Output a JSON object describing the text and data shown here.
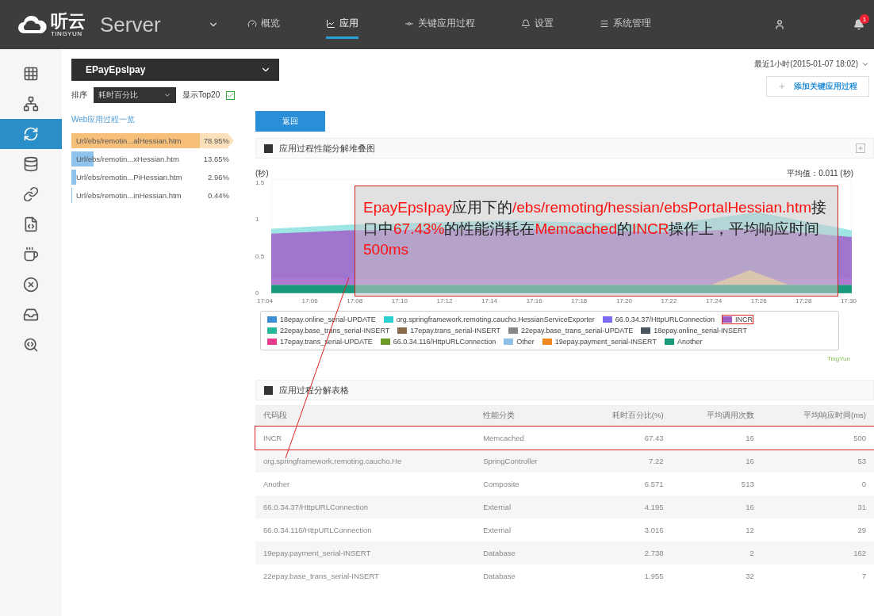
{
  "header": {
    "logo_text": "听云",
    "logo_sub": "TINGYUN",
    "product": "Server",
    "nav": [
      {
        "label": "概览",
        "kind": "gauge",
        "selected": false
      },
      {
        "label": "应用",
        "kind": "chart",
        "selected": true
      },
      {
        "label": "关键应用过程",
        "kind": "commit",
        "selected": false
      },
      {
        "label": "设置",
        "kind": "bell",
        "selected": false
      },
      {
        "label": "系统管理",
        "kind": "list",
        "selected": false
      }
    ],
    "notifications": "1"
  },
  "sidebar": {
    "items": [
      {
        "kind": "grid",
        "selected": false
      },
      {
        "kind": "tree",
        "selected": false
      },
      {
        "kind": "refresh",
        "selected": true
      },
      {
        "kind": "database",
        "selected": false
      },
      {
        "kind": "link",
        "selected": false
      },
      {
        "kind": "code",
        "selected": false
      },
      {
        "kind": "coffee",
        "selected": false
      },
      {
        "kind": "error",
        "selected": false
      },
      {
        "kind": "inbox",
        "selected": false
      },
      {
        "kind": "search",
        "selected": false
      }
    ]
  },
  "app_select": {
    "value": "EPayEpslpay"
  },
  "sort": {
    "label": "排序",
    "value": "耗时百分比",
    "top_label": "显示Top20",
    "top_checked": true
  },
  "time_range": "最近1小时(2015-01-07 18:02)",
  "add_button": "添加关键应用过程",
  "process_list": {
    "title": "Web应用过程一览",
    "items": [
      {
        "label": "Url/ebs/remotin...alHessian.htm",
        "percent": "78.95%",
        "level": 0.7895,
        "selected": true
      },
      {
        "label": "Url/ebs/remotin...xHessian.htm",
        "percent": "13.65%",
        "level": 0.1365,
        "selected": false
      },
      {
        "label": "Url/ebs/remotin...PiHessian.htm",
        "percent": "2.96%",
        "level": 0.0296,
        "selected": false
      },
      {
        "label": "Url/ebs/remotin...inHessian.htm",
        "percent": "0.44%",
        "level": 0.0044,
        "selected": false
      }
    ]
  },
  "back_button": "返回",
  "chart_panel": {
    "title": "应用过程性能分解堆叠图",
    "unit": "(秒)",
    "average": "平均值：0.011 (秒)",
    "y_ticks": [
      "1.5",
      "1",
      "0.5",
      "0"
    ],
    "x_ticks": [
      "17:04",
      "17:06",
      "17:08",
      "17:10",
      "17:12",
      "17:14",
      "17:16",
      "17:18",
      "17:20",
      "17:22",
      "17:24",
      "17:26",
      "17:28",
      "17:30"
    ],
    "legend": [
      {
        "label": "18epay.online_serial-UPDATE",
        "color": "#3a8fd8",
        "highlighted": false
      },
      {
        "label": "org.springframework.remoting.caucho.HessianServiceExporter",
        "color": "#2ecfcf",
        "highlighted": false
      },
      {
        "label": "66.0.34.37/HttpURLConnection",
        "color": "#7b6cf0",
        "highlighted": false
      },
      {
        "label": "INCR",
        "color": "#a05cc0",
        "highlighted": true
      },
      {
        "label": "22epay.base_trans_serial-INSERT",
        "color": "#26b89a",
        "highlighted": false
      },
      {
        "label": "17epay.trans_serial-INSERT",
        "color": "#8a6a4a",
        "highlighted": false
      },
      {
        "label": "22epay.base_trans_serial-UPDATE",
        "color": "#888888",
        "highlighted": false
      },
      {
        "label": "18epay.online_serial-INSERT",
        "color": "#4a5560",
        "highlighted": false
      },
      {
        "label": "17epay.trans_serial-UPDATE",
        "color": "#e83a8a",
        "highlighted": false
      },
      {
        "label": "66.0.34.116/HttpURLConnection",
        "color": "#6e9a2a",
        "highlighted": false
      },
      {
        "label": "Other",
        "color": "#8ec0e8",
        "highlighted": false
      },
      {
        "label": "19epay.payment_serial-INSERT",
        "color": "#f08a20",
        "highlighted": false
      },
      {
        "label": "Another",
        "color": "#1a9a7a",
        "highlighted": false
      }
    ],
    "credit": "TingYun"
  },
  "table_panel": {
    "title": "应用过程分解表格",
    "columns": [
      "代码段",
      "性能分类",
      "耗时百分比(%)",
      "平均调用次数",
      "平均响应时间(ms)"
    ],
    "rows": [
      {
        "cells": [
          "INCR",
          "Memcached",
          "67.43",
          "16",
          "500"
        ],
        "highlighted": true
      },
      {
        "cells": [
          "org.springframework.remoting.caucho.He",
          "SpringController",
          "7.22",
          "16",
          "53"
        ],
        "highlighted": false
      },
      {
        "cells": [
          "Another",
          "Composite",
          "6.571",
          "513",
          "0"
        ],
        "highlighted": false
      },
      {
        "cells": [
          "66.0.34.37/HttpURLConnection",
          "External",
          "4.195",
          "16",
          "31"
        ],
        "highlighted": false
      },
      {
        "cells": [
          "66.0.34.116/HttpURLConnection",
          "External",
          "3.016",
          "12",
          "29"
        ],
        "highlighted": false
      },
      {
        "cells": [
          "19epay.payment_serial-INSERT",
          "Database",
          "2.738",
          "2",
          "162"
        ],
        "highlighted": false
      },
      {
        "cells": [
          "22epay.base_trans_serial-INSERT",
          "Database",
          "1.955",
          "32",
          "7"
        ],
        "highlighted": false
      }
    ]
  },
  "annotation": {
    "segments": [
      {
        "text": "EpayEpsIpay",
        "emphasis": true
      },
      {
        "text": "应用下的",
        "emphasis": false
      },
      {
        "text": "/ebs/remoting/hessian/ebsPortalHessian.htm",
        "emphasis": true
      },
      {
        "text": "接口中",
        "emphasis": false
      },
      {
        "text": "67.43%",
        "emphasis": true
      },
      {
        "text": "的性能消耗在",
        "emphasis": false
      },
      {
        "text": "Memcached",
        "emphasis": true
      },
      {
        "text": "的",
        "emphasis": false
      },
      {
        "text": "INCR",
        "emphasis": true
      },
      {
        "text": "操作上，平均响应时间",
        "emphasis": false
      },
      {
        "text": "500ms",
        "emphasis": true
      }
    ]
  }
}
